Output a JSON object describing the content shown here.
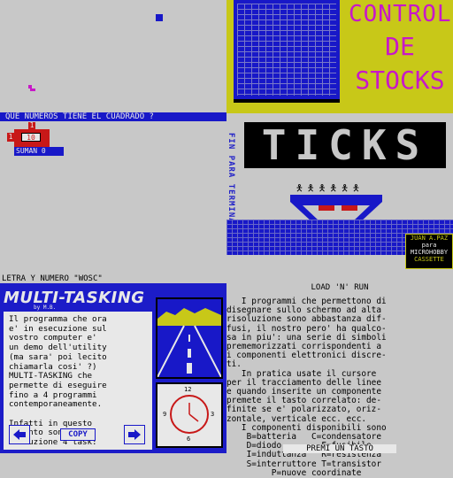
{
  "quiz": {
    "question": "QUE NUMEROS TIENE EL CUADRADO ?",
    "marker_top": "1",
    "marker_left": "1",
    "box_value": "10",
    "sum_label": "SUMAN 0"
  },
  "control_screen": {
    "title_line1": "CONTROL",
    "title_line2": "DE",
    "title_line3": "STOCKS"
  },
  "ticks_screen": {
    "logo": "TICKS",
    "vertical_text": "FIN PARA TERMINAR",
    "badge_line1": "JUAN A.PAZ",
    "badge_line2": "para",
    "badge_line3": "MICROHOBBY",
    "badge_line4": "CASSETTE"
  },
  "letra": {
    "prompt": "LETRA Y NUMERO \"WOSC\""
  },
  "multitasking": {
    "title": "MULTI-TASKING",
    "byline": "by M.B.",
    "body": "Il programma che ora\ne' in esecuzione sul\nvostro computer e'\nun demo dell'utility\n(ma sara' poi lecito\nchiamarla cosi' ?)\nMULTI-TASKING che\npermette di eseguire\nfino a 4 programmi\ncontemporaneamente.\n\nInfatti in questo\nmomento sono in\nesecuzione 4 task:",
    "copy_label": "COPY",
    "clock_12": "12",
    "clock_3": "3",
    "clock_6": "6",
    "clock_9": "9",
    "icon_left": "left-arrow-icon",
    "icon_right": "right-arrow-icon"
  },
  "load_n_run": {
    "title": "LOAD 'N' RUN",
    "body": "   I programmi che permettono di\ndisegnare sullo schermo ad alta\nrisoluzione sono abbastanza dif-\nfusi, il nostro pero' ha qualco-\nsa in piu': una serie di simboli\nprememorizzati corrispondenti a\ni componenti elettronici discre-\nti.\n   In pratica usate il cursore\nper il tracciamento delle linee\ne quando inserite un componente\npremete il tasto correlato: de-\nfinite se e' polarizzato, oriz-\nzontale, verticale ecc. ecc.\n   I componenti disponibili sono\n    B=batteria   C=condensatore\n    D=diodo        F=fusibile\n    I=induttanza   R=resistenza\n    S=interruttore T=transistor\n         P=nuove coordinate",
    "footer": "PREMI UN TASTO"
  },
  "colors": {
    "panel_gray": "#c8c8c8",
    "spectrum_blue": "#1818c8",
    "spectrum_red": "#c81818",
    "spectrum_yellow": "#c8c818",
    "spectrum_magenta": "#c818c8",
    "black": "#000000",
    "white": "#e8e8e8"
  }
}
